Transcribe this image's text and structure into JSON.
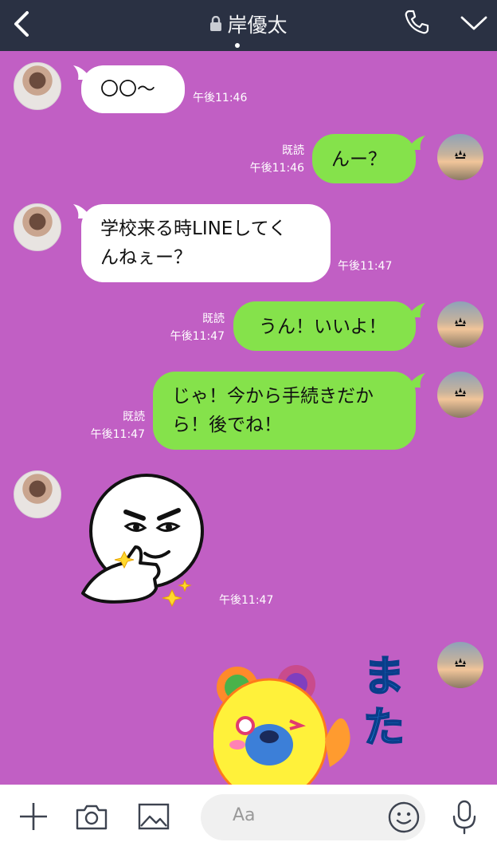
{
  "header": {
    "title": "岸優太",
    "icons": [
      "back-arrow-icon",
      "lock-icon",
      "phone-icon",
      "chevron-down-icon"
    ]
  },
  "messages": [
    {
      "from": "friend",
      "type": "text",
      "text": "〇〇〜",
      "time": "午後11:46"
    },
    {
      "from": "me",
      "type": "text",
      "text": "んー？",
      "time": "午後11:46",
      "read": "既読"
    },
    {
      "from": "friend",
      "type": "text",
      "lines": [
        "学校来る時LINEしてく",
        "んねぇー？"
      ],
      "time": "午後11:47"
    },
    {
      "from": "me",
      "type": "text",
      "text": "うん！いいよ！",
      "time": "午後11:47",
      "read": "既読"
    },
    {
      "from": "me",
      "type": "text",
      "lines": [
        "じゃ！今から手続きだか",
        "ら！後でね！"
      ],
      "time": "午後11:47",
      "read": "既読"
    },
    {
      "from": "friend",
      "type": "sticker",
      "sticker": "moon-thumbs-up-sticker",
      "time": "午後11:47"
    },
    {
      "from": "me",
      "type": "sticker",
      "sticker": "bear-sticker",
      "sticker_text": "また"
    }
  ],
  "composer": {
    "placeholder": "Aa",
    "icons": [
      "plus-icon",
      "camera-icon",
      "image-icon",
      "emoji-icon",
      "microphone-icon"
    ]
  },
  "colors": {
    "background": "#c15fc4",
    "header": "#2a3143",
    "outgoing_bubble": "#85e24b",
    "incoming_bubble": "#ffffff"
  }
}
